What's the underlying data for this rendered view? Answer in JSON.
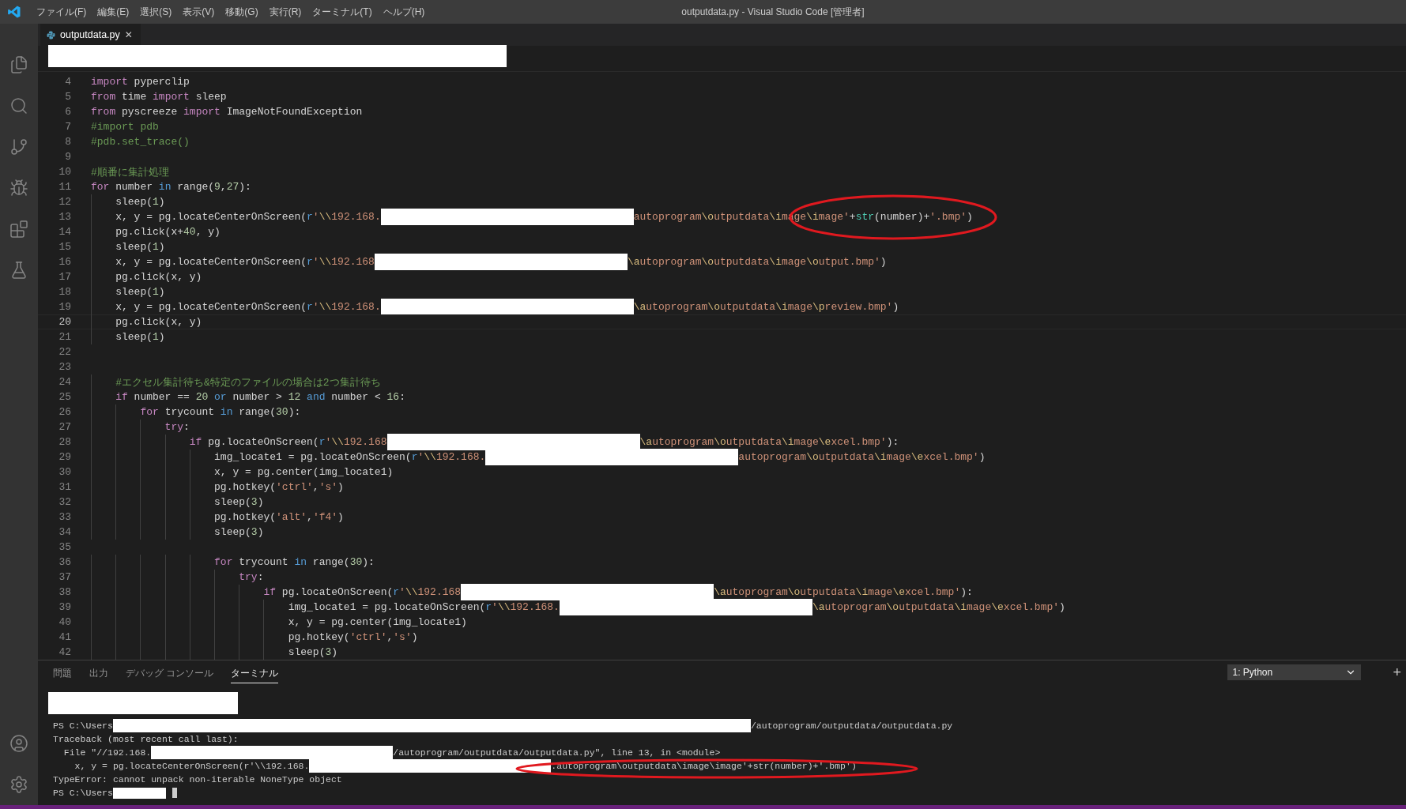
{
  "title_bar": {
    "menu": [
      "ファイル(F)",
      "編集(E)",
      "選択(S)",
      "表示(V)",
      "移動(G)",
      "実行(R)",
      "ターミナル(T)",
      "ヘルプ(H)"
    ],
    "title": "outputdata.py - Visual Studio Code [管理者]"
  },
  "editor": {
    "tab": {
      "label": "outputdata.py",
      "selected": true,
      "close": "✕"
    },
    "lines": [
      {
        "number": "4",
        "current": false,
        "circled": false,
        "segments": [
          {
            "kind": "keyword",
            "text": "import"
          },
          {
            "kind": "plain",
            "text": " pyperclip"
          }
        ]
      },
      {
        "number": "5",
        "current": false,
        "circled": false,
        "segments": [
          {
            "kind": "keyword",
            "text": "from"
          },
          {
            "kind": "plain",
            "text": " time "
          },
          {
            "kind": "keyword",
            "text": "import"
          },
          {
            "kind": "plain",
            "text": " sleep"
          }
        ]
      },
      {
        "number": "6",
        "current": false,
        "circled": false,
        "segments": [
          {
            "kind": "keyword",
            "text": "from"
          },
          {
            "kind": "plain",
            "text": " pyscreeze "
          },
          {
            "kind": "keyword",
            "text": "import"
          },
          {
            "kind": "plain",
            "text": " ImageNotFoundException"
          }
        ]
      },
      {
        "number": "7",
        "current": false,
        "circled": false,
        "segments": [
          {
            "kind": "comment",
            "text": "#import pdb"
          }
        ]
      },
      {
        "number": "8",
        "current": false,
        "circled": false,
        "segments": [
          {
            "kind": "comment",
            "text": "#pdb.set_trace()"
          }
        ]
      },
      {
        "number": "9",
        "current": false,
        "circled": false
      },
      {
        "number": "10",
        "current": false,
        "circled": false,
        "segments": [
          {
            "kind": "comment",
            "text": "#順番に集計処理"
          }
        ]
      },
      {
        "number": "11",
        "current": false,
        "circled": false,
        "segments": [
          {
            "kind": "keyword",
            "text": "for"
          },
          {
            "kind": "plain",
            "text": " number "
          },
          {
            "kind": "operator",
            "text": "in"
          },
          {
            "kind": "plain",
            "text": " range("
          },
          {
            "kind": "number",
            "text": "9"
          },
          {
            "kind": "plain",
            "text": ","
          },
          {
            "kind": "number",
            "text": "27"
          },
          {
            "kind": "plain",
            "text": "):"
          }
        ]
      },
      {
        "number": "12",
        "current": false,
        "circled": false,
        "segments": [
          {
            "kind": "plain",
            "text": "    sleep("
          },
          {
            "kind": "number",
            "text": "1"
          },
          {
            "kind": "plain",
            "text": ")"
          }
        ]
      },
      {
        "number": "13",
        "current": false,
        "circled": true,
        "segments": [
          {
            "kind": "plain",
            "text": "    x, y = pg.locateCenterOnScreen("
          },
          {
            "kind": "operator",
            "text": "r"
          },
          {
            "kind": "string",
            "text": "'\\\\192.168."
          },
          {
            "kind": "redacted"
          },
          {
            "kind": "string",
            "text": "autoprogram\\outputdata\\image\\image'"
          },
          {
            "kind": "plain",
            "text": "+"
          },
          {
            "kind": "builtin",
            "text": "str"
          },
          {
            "kind": "plain",
            "text": "(number)+"
          },
          {
            "kind": "string",
            "text": "'.bmp'"
          },
          {
            "kind": "plain",
            "text": ")"
          }
        ]
      },
      {
        "number": "14",
        "current": false,
        "circled": false,
        "segments": [
          {
            "kind": "plain",
            "text": "    pg.click(x+"
          },
          {
            "kind": "number",
            "text": "40"
          },
          {
            "kind": "plain",
            "text": ", y)"
          }
        ]
      },
      {
        "number": "15",
        "current": false,
        "circled": false,
        "segments": [
          {
            "kind": "plain",
            "text": "    sleep("
          },
          {
            "kind": "number",
            "text": "1"
          },
          {
            "kind": "plain",
            "text": ")"
          }
        ]
      },
      {
        "number": "16",
        "current": false,
        "circled": false,
        "segments": [
          {
            "kind": "plain",
            "text": "    x, y = pg.locateCenterOnScreen("
          },
          {
            "kind": "operator",
            "text": "r"
          },
          {
            "kind": "string",
            "text": "'\\\\192.168"
          },
          {
            "kind": "redacted"
          },
          {
            "kind": "string",
            "text": "\\autoprogram\\outputdata\\image\\output.bmp'"
          },
          {
            "kind": "plain",
            "text": ")"
          }
        ]
      },
      {
        "number": "17",
        "current": false,
        "circled": false,
        "segments": [
          {
            "kind": "plain",
            "text": "    pg.click(x, y)"
          }
        ]
      },
      {
        "number": "18",
        "current": false,
        "circled": false,
        "segments": [
          {
            "kind": "plain",
            "text": "    sleep("
          },
          {
            "kind": "number",
            "text": "1"
          },
          {
            "kind": "plain",
            "text": ")"
          }
        ]
      },
      {
        "number": "19",
        "current": false,
        "circled": false,
        "segments": [
          {
            "kind": "plain",
            "text": "    x, y = pg.locateCenterOnScreen("
          },
          {
            "kind": "operator",
            "text": "r"
          },
          {
            "kind": "string",
            "text": "'\\\\192.168."
          },
          {
            "kind": "redacted"
          },
          {
            "kind": "string",
            "text": "\\autoprogram\\outputdata\\image\\preview.bmp'"
          },
          {
            "kind": "plain",
            "text": ")"
          }
        ]
      },
      {
        "number": "20",
        "current": true,
        "circled": false,
        "segments": [
          {
            "kind": "plain",
            "text": "    pg.click(x, y)"
          }
        ]
      },
      {
        "number": "21",
        "current": false,
        "circled": false,
        "segments": [
          {
            "kind": "plain",
            "text": "    sleep("
          },
          {
            "kind": "number",
            "text": "1"
          },
          {
            "kind": "plain",
            "text": ")"
          }
        ]
      },
      {
        "number": "22",
        "current": false,
        "circled": false
      },
      {
        "number": "23",
        "current": false,
        "circled": false
      },
      {
        "number": "24",
        "current": false,
        "circled": false,
        "segments": [
          {
            "kind": "comment",
            "text": "    #エクセル集計待ち&特定のファイルの場合は2つ集計待ち"
          }
        ]
      },
      {
        "number": "25",
        "current": false,
        "circled": false,
        "segments": [
          {
            "kind": "keyword",
            "text": "    if"
          },
          {
            "kind": "plain",
            "text": " number == "
          },
          {
            "kind": "number",
            "text": "20"
          },
          {
            "kind": "operator",
            "text": " or"
          },
          {
            "kind": "plain",
            "text": " number > "
          },
          {
            "kind": "number",
            "text": "12"
          },
          {
            "kind": "operator",
            "text": " and"
          },
          {
            "kind": "plain",
            "text": " number < "
          },
          {
            "kind": "number",
            "text": "16"
          },
          {
            "kind": "plain",
            "text": ":"
          }
        ]
      },
      {
        "number": "26",
        "current": false,
        "circled": false,
        "segments": [
          {
            "kind": "keyword",
            "text": "        for"
          },
          {
            "kind": "plain",
            "text": " trycount "
          },
          {
            "kind": "operator",
            "text": "in"
          },
          {
            "kind": "plain",
            "text": " range("
          },
          {
            "kind": "number",
            "text": "30"
          },
          {
            "kind": "plain",
            "text": "):"
          }
        ]
      },
      {
        "number": "27",
        "current": false,
        "circled": false,
        "segments": [
          {
            "kind": "keyword",
            "text": "            try"
          },
          {
            "kind": "plain",
            "text": ":"
          }
        ]
      },
      {
        "number": "28",
        "current": false,
        "circled": false,
        "segments": [
          {
            "kind": "keyword",
            "text": "                if"
          },
          {
            "kind": "plain",
            "text": " pg.locateOnScreen("
          },
          {
            "kind": "operator",
            "text": "r"
          },
          {
            "kind": "string",
            "text": "'\\\\192.168"
          },
          {
            "kind": "redacted"
          },
          {
            "kind": "string",
            "text": "\\autoprogram\\outputdata\\image\\excel.bmp'"
          },
          {
            "kind": "plain",
            "text": "):"
          }
        ]
      },
      {
        "number": "29",
        "current": false,
        "circled": false,
        "segments": [
          {
            "kind": "plain",
            "text": "                    img_locate1 = pg.locateOnScreen("
          },
          {
            "kind": "operator",
            "text": "r"
          },
          {
            "kind": "string",
            "text": "'\\\\192.168."
          },
          {
            "kind": "redacted"
          },
          {
            "kind": "string",
            "text": "autoprogram\\outputdata\\image\\excel.bmp'"
          },
          {
            "kind": "plain",
            "text": ")"
          }
        ]
      },
      {
        "number": "30",
        "current": false,
        "circled": false,
        "segments": [
          {
            "kind": "plain",
            "text": "                    x, y = pg.center(img_locate1)"
          }
        ]
      },
      {
        "number": "31",
        "current": false,
        "circled": false,
        "segments": [
          {
            "kind": "plain",
            "text": "                    pg.hotkey("
          },
          {
            "kind": "string",
            "text": "'ctrl'"
          },
          {
            "kind": "plain",
            "text": ","
          },
          {
            "kind": "string",
            "text": "'s'"
          },
          {
            "kind": "plain",
            "text": ")"
          }
        ]
      },
      {
        "number": "32",
        "current": false,
        "circled": false,
        "segments": [
          {
            "kind": "plain",
            "text": "                    sleep("
          },
          {
            "kind": "number",
            "text": "3"
          },
          {
            "kind": "plain",
            "text": ")"
          }
        ]
      },
      {
        "number": "33",
        "current": false,
        "circled": false,
        "segments": [
          {
            "kind": "plain",
            "text": "                    pg.hotkey("
          },
          {
            "kind": "string",
            "text": "'alt'"
          },
          {
            "kind": "plain",
            "text": ","
          },
          {
            "kind": "string",
            "text": "'f4'"
          },
          {
            "kind": "plain",
            "text": ")"
          }
        ]
      },
      {
        "number": "34",
        "current": false,
        "circled": false,
        "segments": [
          {
            "kind": "plain",
            "text": "                    sleep("
          },
          {
            "kind": "number",
            "text": "3"
          },
          {
            "kind": "plain",
            "text": ")"
          }
        ]
      },
      {
        "number": "35",
        "current": false,
        "circled": false
      },
      {
        "number": "36",
        "current": false,
        "circled": false,
        "segments": [
          {
            "kind": "keyword",
            "text": "                    for"
          },
          {
            "kind": "plain",
            "text": " trycount "
          },
          {
            "kind": "operator",
            "text": "in"
          },
          {
            "kind": "plain",
            "text": " range("
          },
          {
            "kind": "number",
            "text": "30"
          },
          {
            "kind": "plain",
            "text": "):"
          }
        ]
      },
      {
        "number": "37",
        "current": false,
        "circled": false,
        "segments": [
          {
            "kind": "keyword",
            "text": "                        try"
          },
          {
            "kind": "plain",
            "text": ":"
          }
        ]
      },
      {
        "number": "38",
        "current": false,
        "circled": false,
        "segments": [
          {
            "kind": "keyword",
            "text": "                            if"
          },
          {
            "kind": "plain",
            "text": " pg.locateOnScreen("
          },
          {
            "kind": "operator",
            "text": "r"
          },
          {
            "kind": "string",
            "text": "'\\\\192.168"
          },
          {
            "kind": "redacted"
          },
          {
            "kind": "string",
            "text": "\\autoprogram\\outputdata\\image\\excel.bmp'"
          },
          {
            "kind": "plain",
            "text": "):"
          }
        ]
      },
      {
        "number": "39",
        "current": false,
        "circled": false,
        "segments": [
          {
            "kind": "plain",
            "text": "                                img_locate1 = pg.locateOnScreen("
          },
          {
            "kind": "operator",
            "text": "r"
          },
          {
            "kind": "string",
            "text": "'\\\\192.168."
          },
          {
            "kind": "redacted"
          },
          {
            "kind": "string",
            "text": "\\autoprogram\\outputdata\\image\\excel.bmp'"
          },
          {
            "kind": "plain",
            "text": ")"
          }
        ]
      },
      {
        "number": "40",
        "current": false,
        "circled": false,
        "segments": [
          {
            "kind": "plain",
            "text": "                                x, y = pg.center(img_locate1)"
          }
        ]
      },
      {
        "number": "41",
        "current": false,
        "circled": false,
        "segments": [
          {
            "kind": "plain",
            "text": "                                pg.hotkey("
          },
          {
            "kind": "string",
            "text": "'ctrl'"
          },
          {
            "kind": "plain",
            "text": ","
          },
          {
            "kind": "string",
            "text": "'s'"
          },
          {
            "kind": "plain",
            "text": ")"
          }
        ]
      },
      {
        "number": "42",
        "current": false,
        "circled": false,
        "segments": [
          {
            "kind": "plain",
            "text": "                                sleep("
          },
          {
            "kind": "number",
            "text": "3"
          },
          {
            "kind": "plain",
            "text": ")"
          }
        ]
      }
    ]
  },
  "panel": {
    "tabs": [
      {
        "label": "問題",
        "selected": false
      },
      {
        "label": "出力",
        "selected": false
      },
      {
        "label": "デバッグ コンソール",
        "selected": false
      },
      {
        "label": "ターミナル",
        "selected": true
      }
    ],
    "terminal_selector": "1: Python",
    "add_button": "+",
    "terminal_lines": [
      {
        "circled": false,
        "cursor": false,
        "segments": [
          {
            "kind": "redacted-bar"
          }
        ]
      },
      {
        "circled": false,
        "cursor": false,
        "segments": [
          {
            "kind": "plain",
            "text": "PS C:\\Users"
          },
          {
            "kind": "redacted-long"
          },
          {
            "kind": "plain",
            "text": "/autoprogram/outputdata/outputdata.py"
          }
        ]
      },
      {
        "circled": false,
        "cursor": false,
        "segments": [
          {
            "kind": "plain",
            "text": "Traceback (most recent call last):"
          }
        ]
      },
      {
        "circled": false,
        "cursor": false,
        "segments": [
          {
            "kind": "plain",
            "text": "  File \"//192.168."
          },
          {
            "kind": "redacted-mid"
          },
          {
            "kind": "plain",
            "text": "/autoprogram/outputdata/outputdata.py\", line 13, in <module>"
          }
        ]
      },
      {
        "circled": true,
        "cursor": false,
        "segments": [
          {
            "kind": "plain",
            "text": "    x, y = pg.locateCenterOnScreen(r'\\\\192.168."
          },
          {
            "kind": "redacted-mid"
          },
          {
            "kind": "plain",
            "text": ".autoprogram\\outputdata\\image\\image'+str(number)+'.bmp')"
          }
        ]
      },
      {
        "circled": false,
        "cursor": false,
        "segments": [
          {
            "kind": "plain",
            "text": "TypeError: cannot unpack non-iterable NoneType object"
          }
        ]
      },
      {
        "circled": false,
        "cursor": true,
        "segments": [
          {
            "kind": "plain",
            "text": "PS C:\\Users"
          },
          {
            "kind": "redacted-short"
          }
        ]
      }
    ]
  }
}
